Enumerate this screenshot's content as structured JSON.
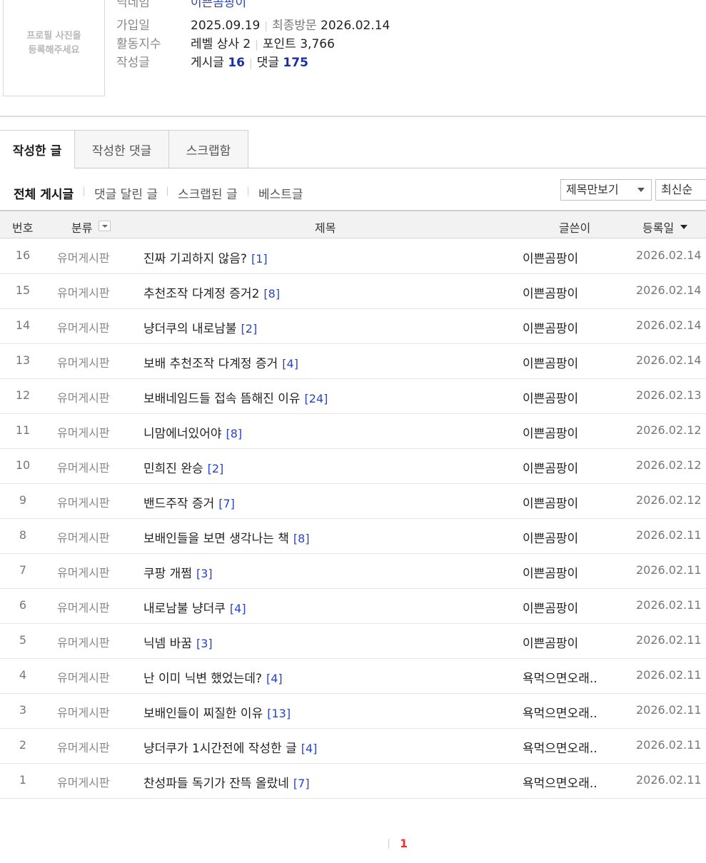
{
  "profile": {
    "photo_placeholder": "프로필 사진을\n등록해주세요",
    "nickname_label": "닉네임",
    "nickname_value": "이쁜곰팡이",
    "join_label": "가입일",
    "join_date": "2025.09.19",
    "last_visit_label": "최종방문",
    "last_visit_date": "2026.02.14",
    "activity_label": "활동지수",
    "level_text": "레벨 상사 2",
    "points_text": "포인트 3,766",
    "written_label": "작성글",
    "posts_label": "게시글",
    "posts_count": "16",
    "comments_label": "댓글",
    "comments_count": "175"
  },
  "tabs": [
    {
      "label": "작성한 글",
      "active": true
    },
    {
      "label": "작성한 댓글",
      "active": false
    },
    {
      "label": "스크랩함",
      "active": false
    }
  ],
  "subnav": [
    {
      "label": "전체 게시글",
      "active": true
    },
    {
      "label": "댓글 달린 글",
      "active": false
    },
    {
      "label": "스크랩된 글",
      "active": false
    },
    {
      "label": "베스트글",
      "active": false
    }
  ],
  "view_select": "제목만보기",
  "sort_select": "최신순",
  "table": {
    "headers": {
      "num": "번호",
      "category": "분류",
      "title": "제목",
      "author": "글쓴이",
      "date": "등록일"
    },
    "rows": [
      {
        "num": "16",
        "category": "유머게시판",
        "title": "진짜 기괴하지 않음?",
        "comments": "[1]",
        "author": "이쁜곰팡이",
        "date": "2026.02.14"
      },
      {
        "num": "15",
        "category": "유머게시판",
        "title": "추천조작 다계정 증거2",
        "comments": "[8]",
        "author": "이쁜곰팡이",
        "date": "2026.02.14"
      },
      {
        "num": "14",
        "category": "유머게시판",
        "title": "냥더쿠의 내로남불",
        "comments": "[2]",
        "author": "이쁜곰팡이",
        "date": "2026.02.14"
      },
      {
        "num": "13",
        "category": "유머게시판",
        "title": "보배 추천조작 다계정 증거",
        "comments": "[4]",
        "author": "이쁜곰팡이",
        "date": "2026.02.14"
      },
      {
        "num": "12",
        "category": "유머게시판",
        "title": "보배네임드들 접속 뜸해진 이유",
        "comments": "[24]",
        "author": "이쁜곰팡이",
        "date": "2026.02.13"
      },
      {
        "num": "11",
        "category": "유머게시판",
        "title": "니맘에너있어야",
        "comments": "[8]",
        "author": "이쁜곰팡이",
        "date": "2026.02.12"
      },
      {
        "num": "10",
        "category": "유머게시판",
        "title": "민희진 완승",
        "comments": "[2]",
        "author": "이쁜곰팡이",
        "date": "2026.02.12"
      },
      {
        "num": "9",
        "category": "유머게시판",
        "title": "밴드주작 증거",
        "comments": "[7]",
        "author": "이쁜곰팡이",
        "date": "2026.02.12"
      },
      {
        "num": "8",
        "category": "유머게시판",
        "title": "보배인들을 보면 생각나는 책",
        "comments": "[8]",
        "author": "이쁜곰팡이",
        "date": "2026.02.11"
      },
      {
        "num": "7",
        "category": "유머게시판",
        "title": "쿠팡 개쩜",
        "comments": "[3]",
        "author": "이쁜곰팡이",
        "date": "2026.02.11"
      },
      {
        "num": "6",
        "category": "유머게시판",
        "title": "내로남불 냥더쿠",
        "comments": "[4]",
        "author": "이쁜곰팡이",
        "date": "2026.02.11"
      },
      {
        "num": "5",
        "category": "유머게시판",
        "title": "닉넴 바꿈",
        "comments": "[3]",
        "author": "이쁜곰팡이",
        "date": "2026.02.11"
      },
      {
        "num": "4",
        "category": "유머게시판",
        "title": "난 이미 닉변 했었는데?",
        "comments": "[4]",
        "author": "욕먹으면오래..",
        "date": "2026.02.11"
      },
      {
        "num": "3",
        "category": "유머게시판",
        "title": "보배인들이 찌질한 이유",
        "comments": "[13]",
        "author": "욕먹으면오래..",
        "date": "2026.02.11"
      },
      {
        "num": "2",
        "category": "유머게시판",
        "title": "냥더쿠가 1시간전에 작성한 글",
        "comments": "[4]",
        "author": "욕먹으면오래..",
        "date": "2026.02.11"
      },
      {
        "num": "1",
        "category": "유머게시판",
        "title": "찬성파들 독기가 잔뜩 올랐네",
        "comments": "[7]",
        "author": "욕먹으면오래..",
        "date": "2026.02.11"
      }
    ]
  },
  "pagination": {
    "current": "1"
  },
  "colors": {
    "link_blue": "#2a44c8",
    "count_blue": "#1b2fa6",
    "page_red": "#e33"
  }
}
